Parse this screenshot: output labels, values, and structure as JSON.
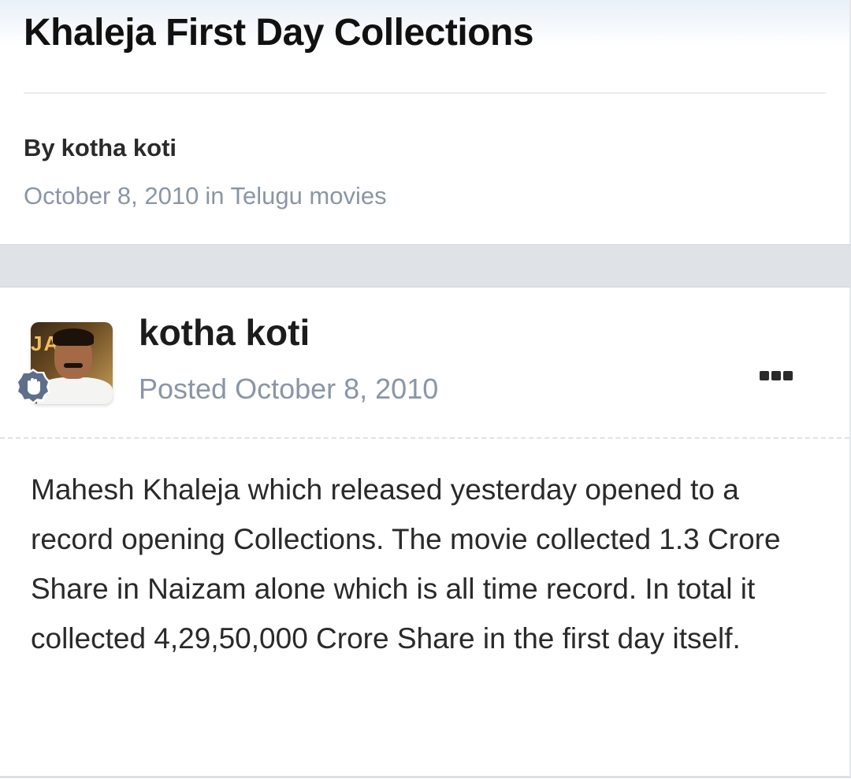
{
  "topic": {
    "title": "Khaleja First Day Collections",
    "by_prefix": "By",
    "author": "kotha koti",
    "date": "October 8, 2010",
    "in_label": "in",
    "forum": "Telugu movies"
  },
  "post": {
    "author": "kotha koti",
    "posted_label": "Posted",
    "date": "October 8, 2010",
    "avatar_letters": "JA",
    "body": "Mahesh Khaleja which released yesterday opened to a record opening Collections. The movie collected 1.3 Crore Share in Naizam alone which is all time record. In total it collected 4,29,50,000 Crore Share in the first day itself."
  },
  "colors": {
    "meta_text": "#8a96a6",
    "band": "#dfe3e8",
    "badge": "#5d6f8a"
  },
  "icons": {
    "rank_badge": "waving-hand-badge-icon",
    "more_menu": "more-options-icon"
  }
}
